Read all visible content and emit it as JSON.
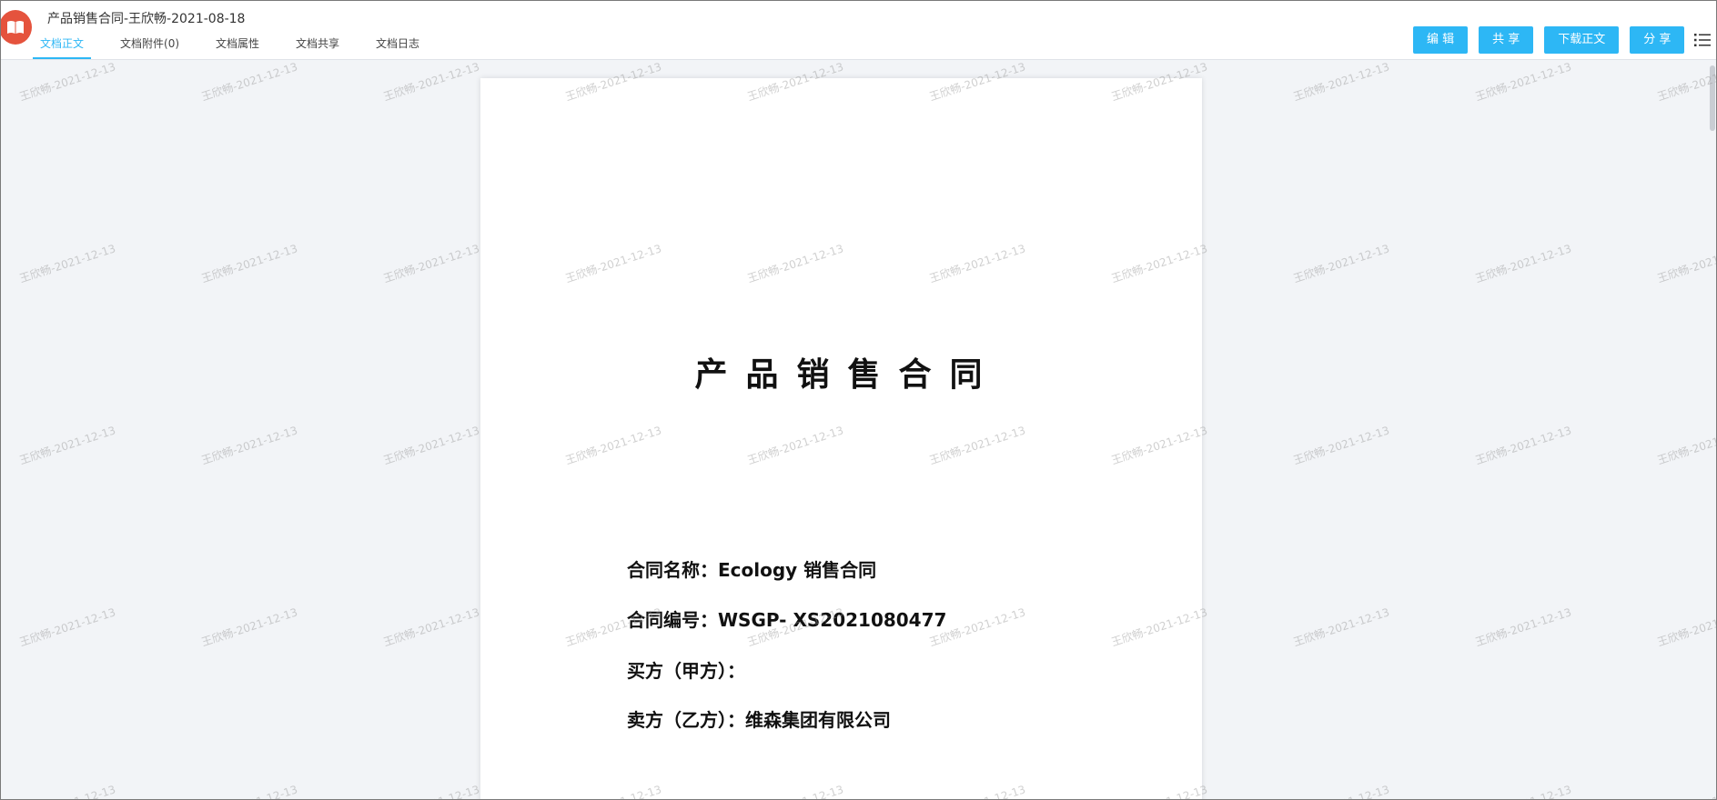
{
  "header": {
    "title": "产品销售合同-王欣畅-2021-08-18",
    "logo_icon": "book-icon",
    "tabs": [
      {
        "label": "文档正文",
        "active": true
      },
      {
        "label": "文档附件(0)",
        "active": false
      },
      {
        "label": "文档属性",
        "active": false
      },
      {
        "label": "文档共享",
        "active": false
      },
      {
        "label": "文档日志",
        "active": false
      }
    ],
    "actions": {
      "edit_label": "编 辑",
      "share_label": "共 享",
      "download_label": "下载正文",
      "forward_label": "分 享"
    },
    "menu_icon": "list-menu-icon"
  },
  "document": {
    "title": "产品销售合同",
    "fields": [
      "合同名称：Ecology 销售合同",
      "合同编号：WSGP- XS2021080477",
      "买方（甲方）：",
      "卖方（乙方）：维森集团有限公司"
    ]
  },
  "watermark_text": "王欣畅-2021-12-13",
  "colors": {
    "accent": "#2db7f5",
    "logo": "#e5533d",
    "background": "#f2f4f7"
  }
}
